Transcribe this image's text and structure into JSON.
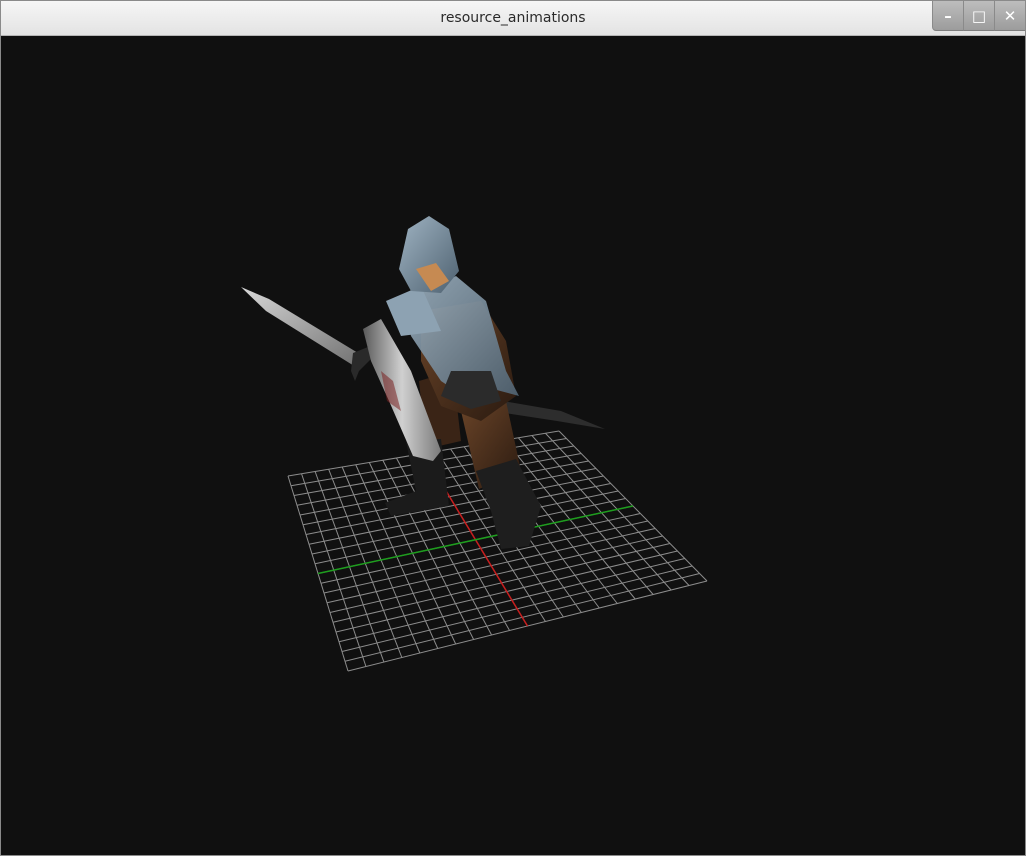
{
  "window": {
    "title": "resource_animations",
    "minimize_label": "–",
    "maximize_label": "□",
    "close_label": "✕"
  },
  "colors": {
    "viewport_background": "#101010",
    "grid_line": "#8c8c8c",
    "axis_x": "#c81e1e",
    "axis_y": "#1e9e1e"
  },
  "scene": {
    "grid_divisions": 20,
    "model": "armored-knight-with-sword-and-shield"
  }
}
